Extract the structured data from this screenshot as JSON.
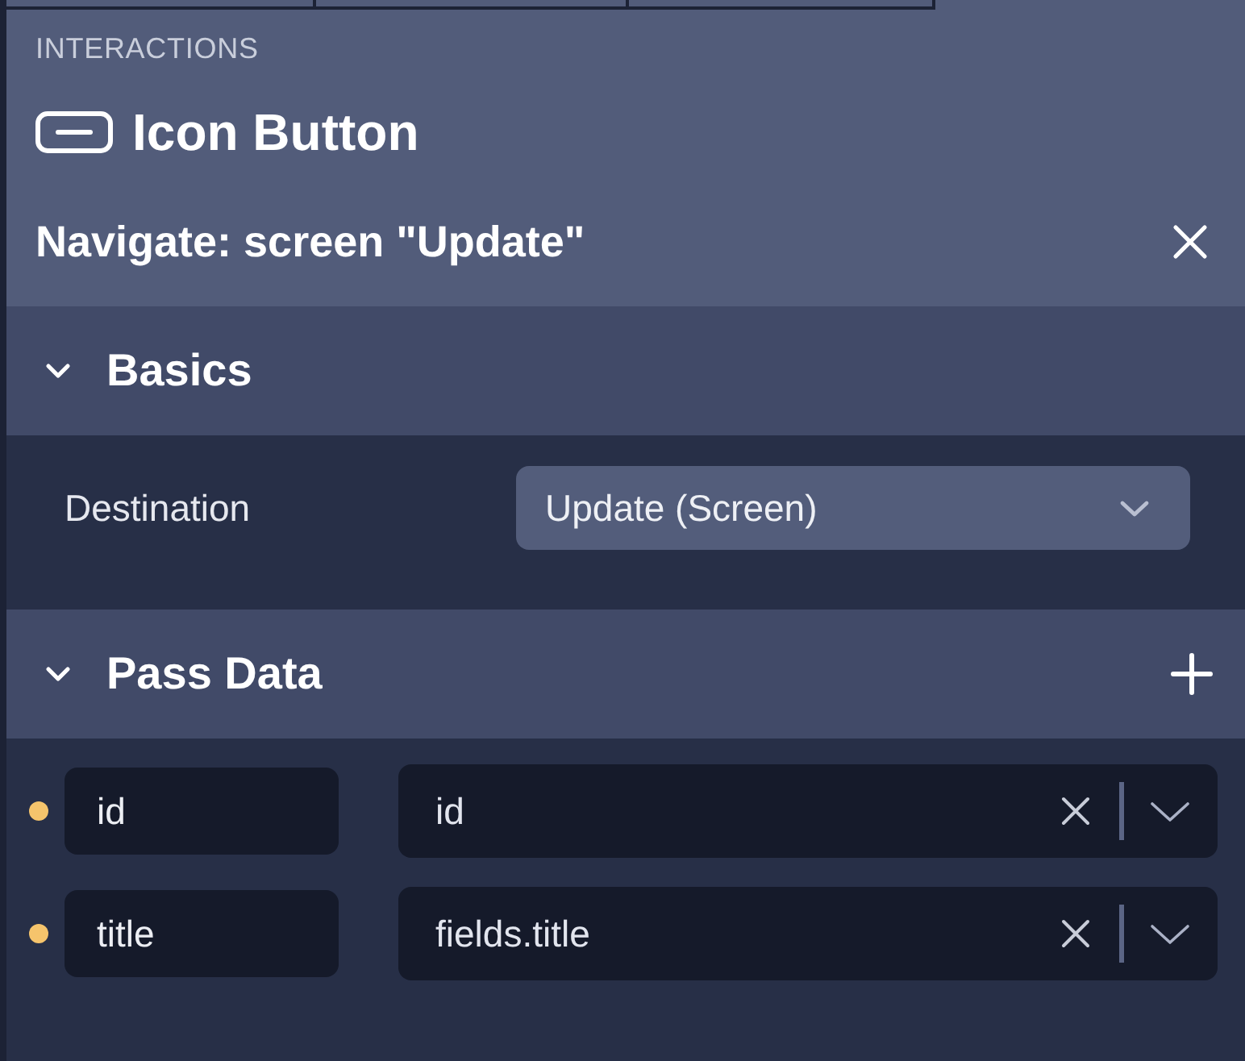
{
  "panel_label": "INTERACTIONS",
  "component": {
    "title": "Icon Button"
  },
  "action": {
    "title": "Navigate: screen \"Update\""
  },
  "sections": [
    {
      "kind": "settings",
      "title": "Basics",
      "expanded": true,
      "fields": [
        {
          "label": "Destination",
          "value": "Update (Screen)"
        }
      ]
    },
    {
      "kind": "parameters",
      "title": "Pass Data",
      "expanded": true,
      "params": [
        {
          "name": "id",
          "value": "id"
        },
        {
          "name": "title",
          "value": "fields.title"
        }
      ]
    }
  ]
}
